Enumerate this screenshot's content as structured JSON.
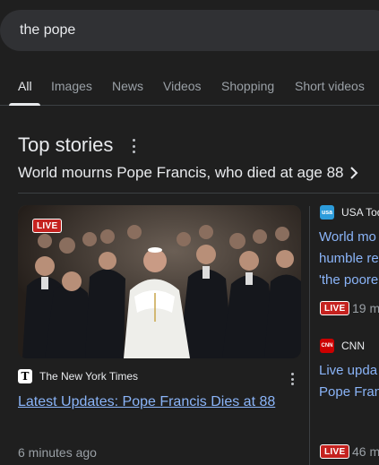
{
  "search": {
    "query": "the pope"
  },
  "tabs": [
    {
      "label": "All",
      "active": true
    },
    {
      "label": "Images",
      "active": false
    },
    {
      "label": "News",
      "active": false
    },
    {
      "label": "Videos",
      "active": false
    },
    {
      "label": "Shopping",
      "active": false
    },
    {
      "label": "Short videos",
      "active": false
    }
  ],
  "top_stories": {
    "title": "Top stories",
    "headline": "World mourns Pope Francis, who died at age 88"
  },
  "main_card": {
    "live_label": "LIVE",
    "source": "The New York Times",
    "source_logo": "ᵗ",
    "title": "Latest Updates: Pope Francis Dies at 88",
    "time": "6 minutes ago"
  },
  "side_card_1": {
    "source": "USA Tod",
    "source_logo": "usa",
    "title_lines": [
      "World mo",
      "humble re",
      "'the poore"
    ],
    "live_label": "LIVE",
    "time": "19 m"
  },
  "side_card_2": {
    "source": "CNN",
    "source_logo": "CNN",
    "title_lines": [
      "Live upda",
      "Pope Fran"
    ],
    "live_label": "LIVE",
    "time": "46 m"
  },
  "colors": {
    "background": "#1f1f1f",
    "link": "#8ab4f8",
    "live_red": "#c5221f",
    "muted_text": "#9aa0a6"
  }
}
